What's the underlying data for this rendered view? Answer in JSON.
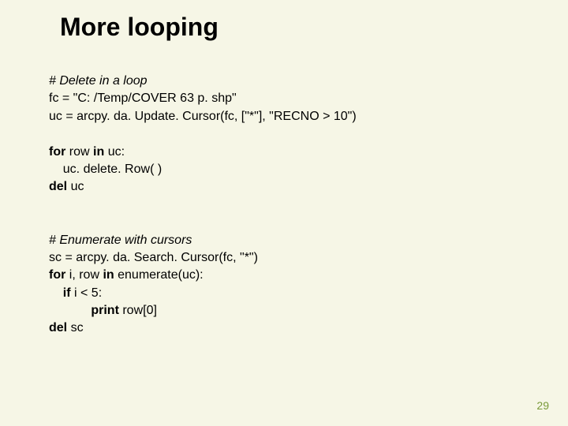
{
  "title": "More looping",
  "pageNumber": "29",
  "lines": [
    {
      "text": "# Delete in a loop",
      "style": "italic"
    },
    {
      "text": "fc = \"C: /Temp/COVER 63 p. shp\"",
      "style": "plain"
    },
    {
      "text": "uc = arcpy. da. Update. Cursor(fc, [\"*\"], \"RECNO > 10\")",
      "style": "plain"
    },
    {
      "text": "",
      "style": "plain"
    },
    {
      "segments": [
        {
          "t": "for ",
          "b": true
        },
        {
          "t": "row "
        },
        {
          "t": "in ",
          "b": true
        },
        {
          "t": "uc:"
        }
      ]
    },
    {
      "text": "    uc. delete. Row( )",
      "style": "plain"
    },
    {
      "segments": [
        {
          "t": "del ",
          "b": true
        },
        {
          "t": "uc"
        }
      ]
    },
    {
      "text": "",
      "style": "plain"
    },
    {
      "text": "",
      "style": "plain"
    },
    {
      "text": "# Enumerate with cursors",
      "style": "italic"
    },
    {
      "text": "sc = arcpy. da. Search. Cursor(fc, \"*\")",
      "style": "plain"
    },
    {
      "segments": [
        {
          "t": "for ",
          "b": true
        },
        {
          "t": "i, row "
        },
        {
          "t": "in ",
          "b": true
        },
        {
          "t": "enumerate(uc):"
        }
      ]
    },
    {
      "segments": [
        {
          "t": "    "
        },
        {
          "t": "if ",
          "b": true
        },
        {
          "t": "i < 5:"
        }
      ]
    },
    {
      "segments": [
        {
          "t": "            "
        },
        {
          "t": "print ",
          "b": true
        },
        {
          "t": "row[0]"
        }
      ]
    },
    {
      "segments": [
        {
          "t": "del ",
          "b": true
        },
        {
          "t": "sc"
        }
      ]
    }
  ]
}
